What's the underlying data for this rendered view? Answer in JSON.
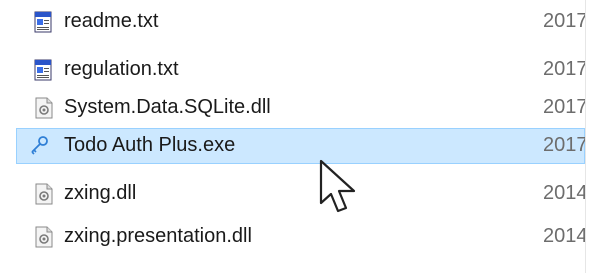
{
  "files": [
    {
      "name": "readme.txt",
      "date": "2017",
      "icon": "text-document-icon"
    },
    {
      "name": "regulation.txt",
      "date": "2017",
      "icon": "text-document-icon"
    },
    {
      "name": "System.Data.SQLite.dll",
      "date": "2017",
      "icon": "dll-file-icon"
    },
    {
      "name": "Todo Auth Plus.exe",
      "date": "2017",
      "icon": "app-executable-icon",
      "selected": true
    },
    {
      "name": "zxing.dll",
      "date": "2014",
      "icon": "dll-file-icon"
    },
    {
      "name": "zxing.presentation.dll",
      "date": "2014",
      "icon": "dll-file-icon"
    }
  ],
  "colors": {
    "selection_bg": "#cce8ff",
    "selection_border": "#99d1ff",
    "text": "#1a1a1a",
    "date_text": "#6d6d6d"
  }
}
